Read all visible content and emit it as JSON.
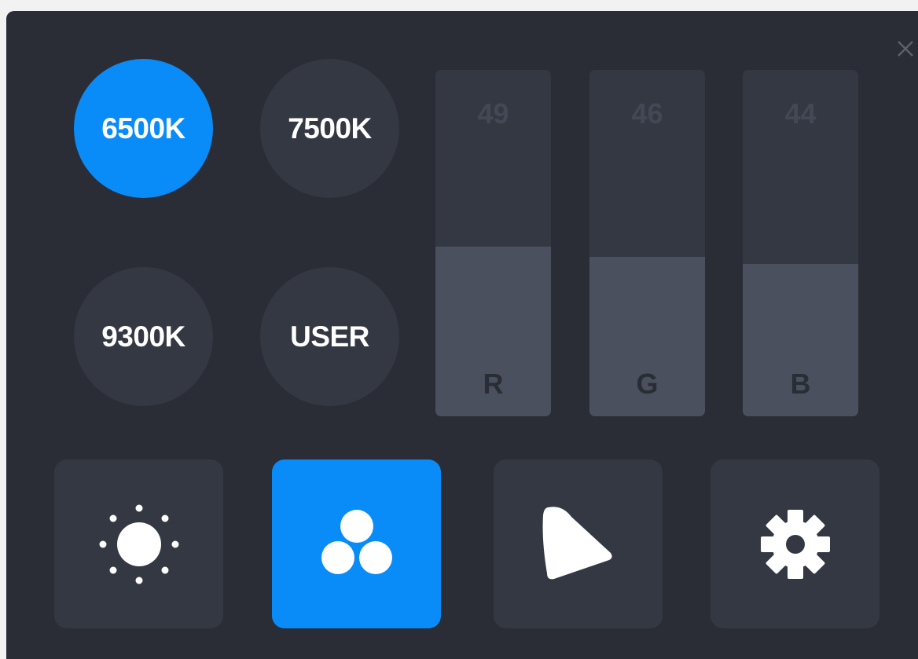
{
  "close": {
    "icon": "close-icon"
  },
  "presets": [
    {
      "label": "6500K",
      "active": true
    },
    {
      "label": "7500K",
      "active": false
    },
    {
      "label": "9300K",
      "active": false
    },
    {
      "label": "USER",
      "active": false
    }
  ],
  "sliders": [
    {
      "channel": "R",
      "value": "49",
      "level": 0.49
    },
    {
      "channel": "G",
      "value": "46",
      "level": 0.46
    },
    {
      "channel": "B",
      "value": "44",
      "level": 0.44
    }
  ],
  "modes": [
    {
      "icon": "brightness-icon",
      "active": false
    },
    {
      "icon": "color-temperature-icon",
      "active": true
    },
    {
      "icon": "gamut-icon",
      "active": false
    },
    {
      "icon": "settings-gear-icon",
      "active": false
    }
  ],
  "colors": {
    "accent": "#0a8cf8",
    "panel_bg": "#2a2d35",
    "button_bg": "#343843",
    "slider_fill": "#4a505d"
  }
}
